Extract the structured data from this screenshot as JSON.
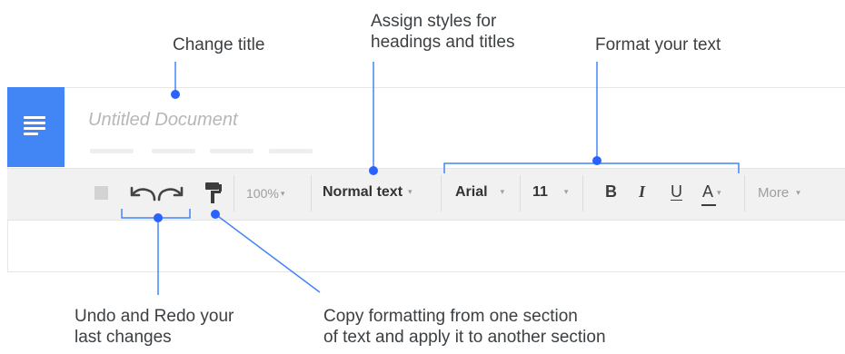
{
  "document": {
    "title": "Untitled Document"
  },
  "toolbar": {
    "zoom": "100%",
    "style": "Normal text",
    "font": "Arial",
    "size": "11",
    "bold": "B",
    "italic": "I",
    "underline": "U",
    "text_color": "A",
    "more": "More",
    "caret": "▾"
  },
  "annotations": {
    "change_title": "Change title",
    "assign_styles_line1": "Assign styles for",
    "assign_styles_line2": "headings and titles",
    "format_text": "Format your text",
    "undo_redo_line1": "Undo and Redo your",
    "undo_redo_line2": "last changes",
    "paint_format_line1": "Copy formatting from one section",
    "paint_format_line2": "of text and apply it to another section"
  },
  "colors": {
    "accent": "#4285f4",
    "toolbar_bg": "#f1f1f1",
    "title_placeholder": "#b7b7b7"
  }
}
